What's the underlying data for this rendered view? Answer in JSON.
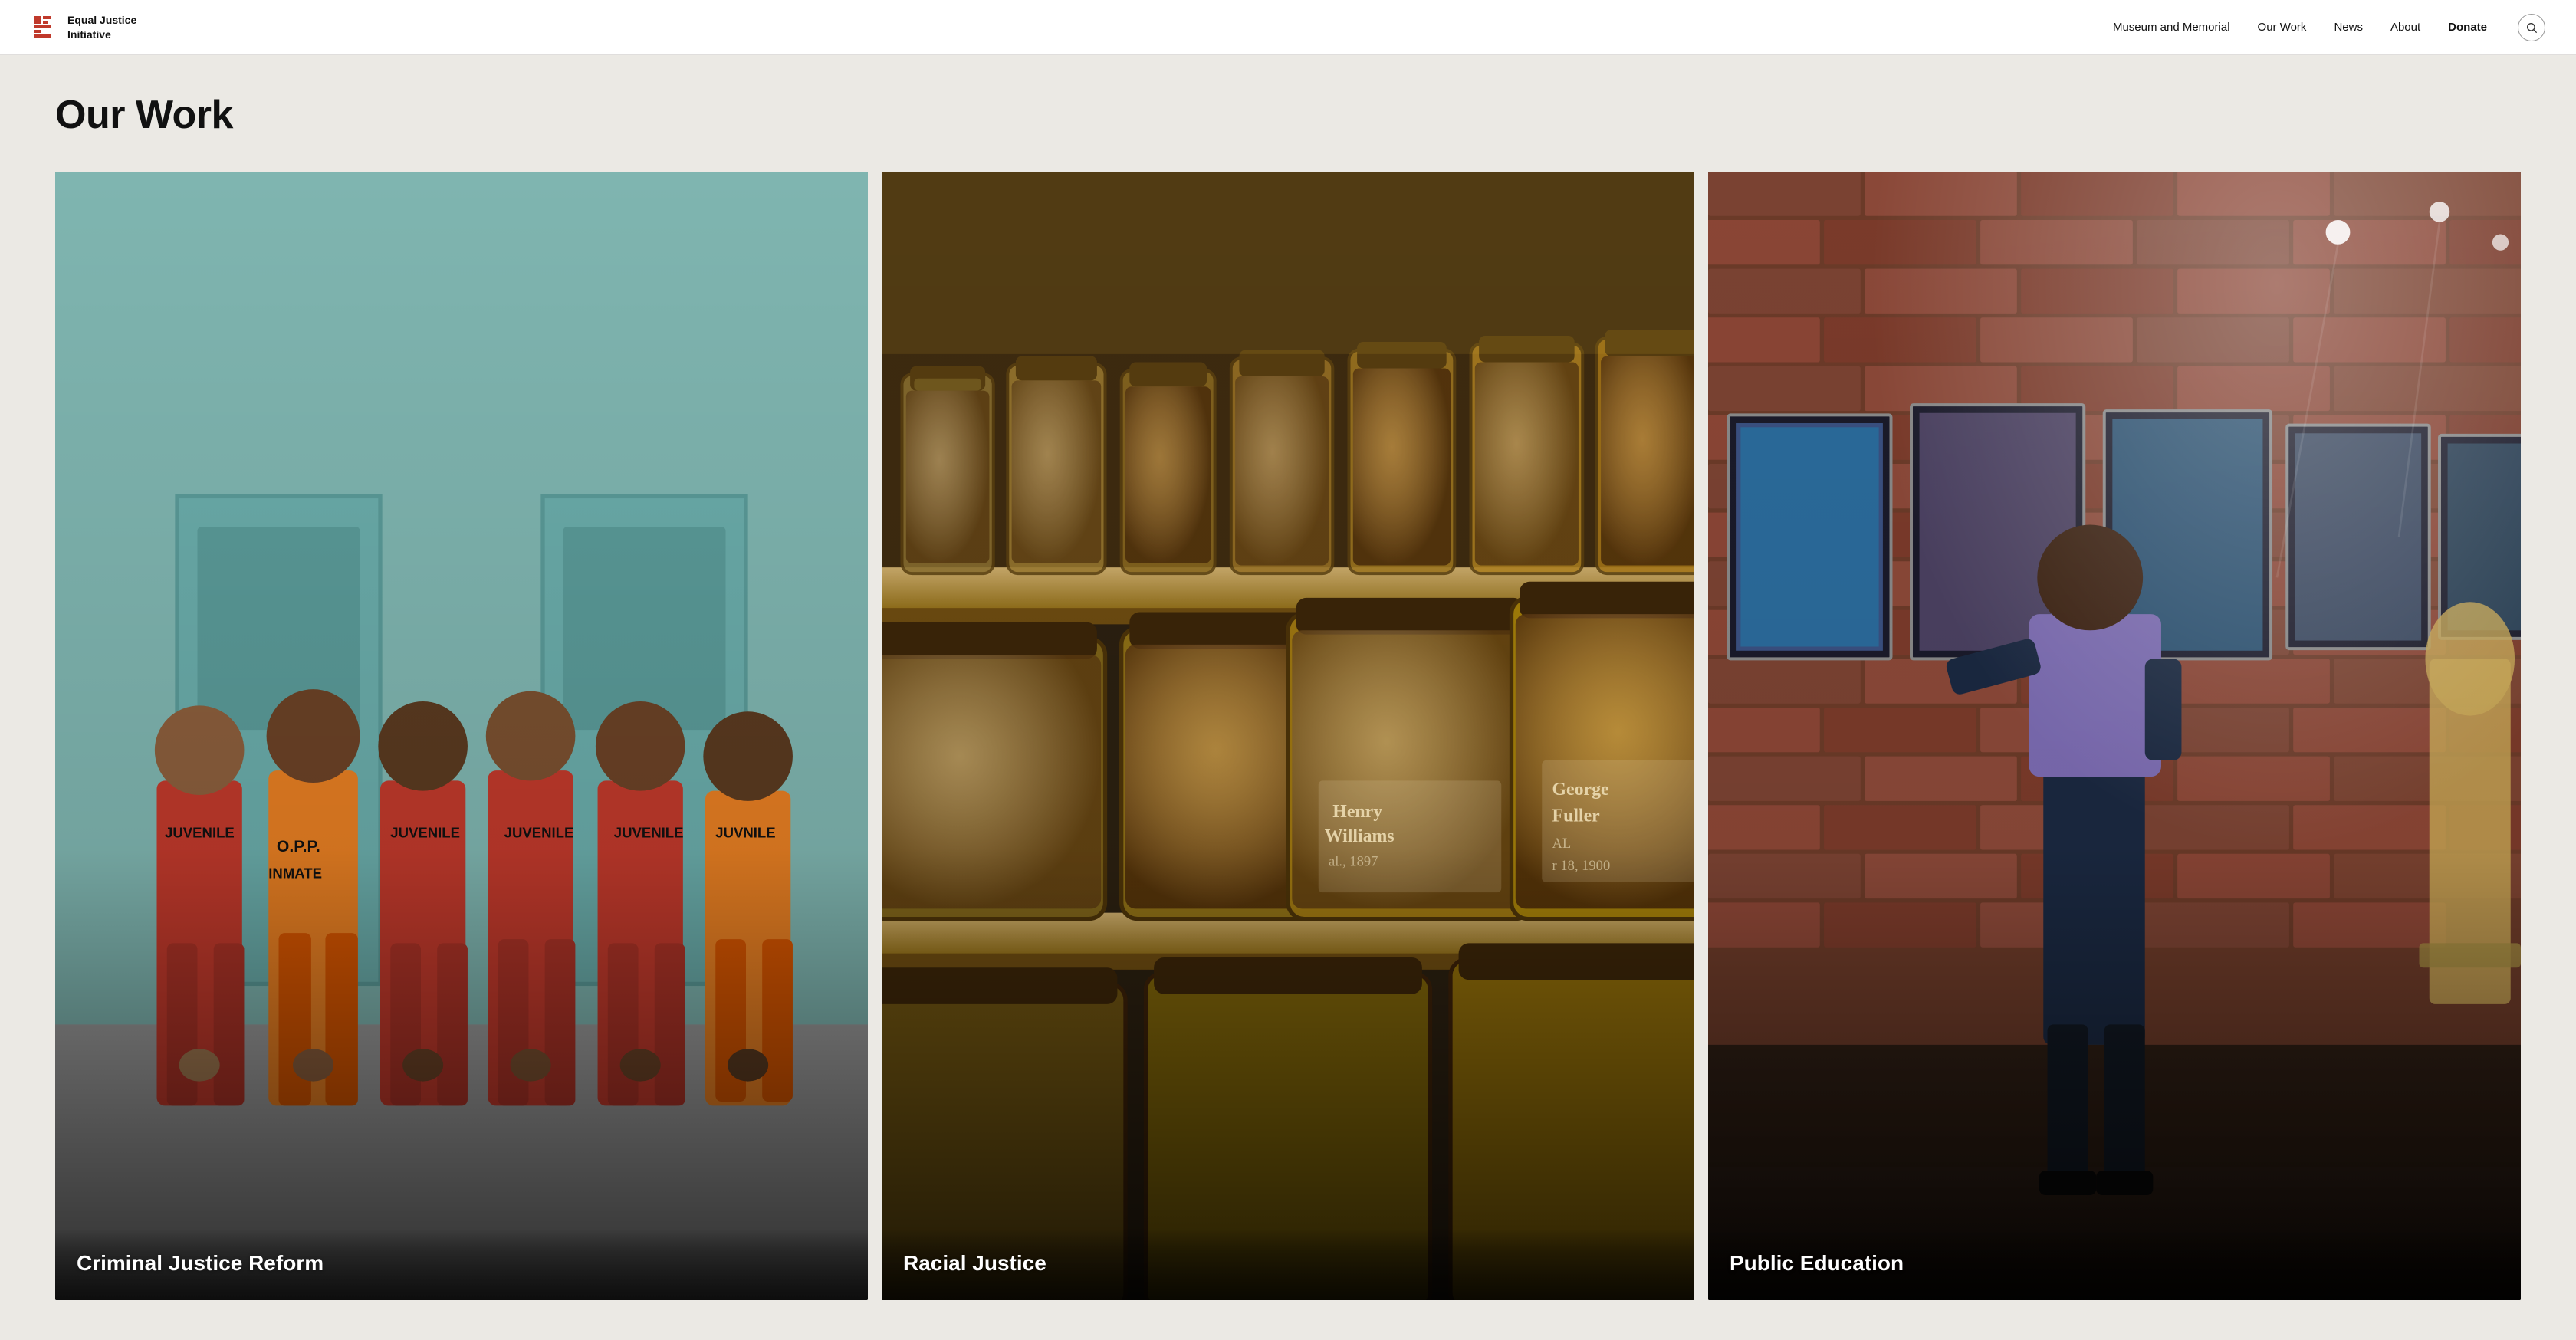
{
  "header": {
    "logo_line1": "Equal Justice",
    "logo_line2": "Initiative",
    "nav": [
      {
        "label": "Museum and Memorial",
        "id": "museum"
      },
      {
        "label": "Our Work",
        "id": "our-work"
      },
      {
        "label": "News",
        "id": "news"
      },
      {
        "label": "About",
        "id": "about"
      },
      {
        "label": "Donate",
        "id": "donate"
      }
    ],
    "search_label": "Search"
  },
  "page": {
    "title": "Our Work"
  },
  "cards": [
    {
      "id": "criminal-justice",
      "label": "Criminal Justice Reform",
      "bg_color_top": "#6b7c6b",
      "bg_color_mid": "#c0392b",
      "description": "People in red and orange jumpsuits facing doors in a facility"
    },
    {
      "id": "racial-justice",
      "label": "Racial Justice",
      "bg_color_top": "#7a5c35",
      "bg_color_mid": "#8b6914",
      "description": "Jars of soil on wooden shelves"
    },
    {
      "id": "public-education",
      "label": "Public Education",
      "bg_color_top": "#8b5e52",
      "bg_color_mid": "#a0522d",
      "description": "Person looking at exhibits on brick wall"
    }
  ]
}
